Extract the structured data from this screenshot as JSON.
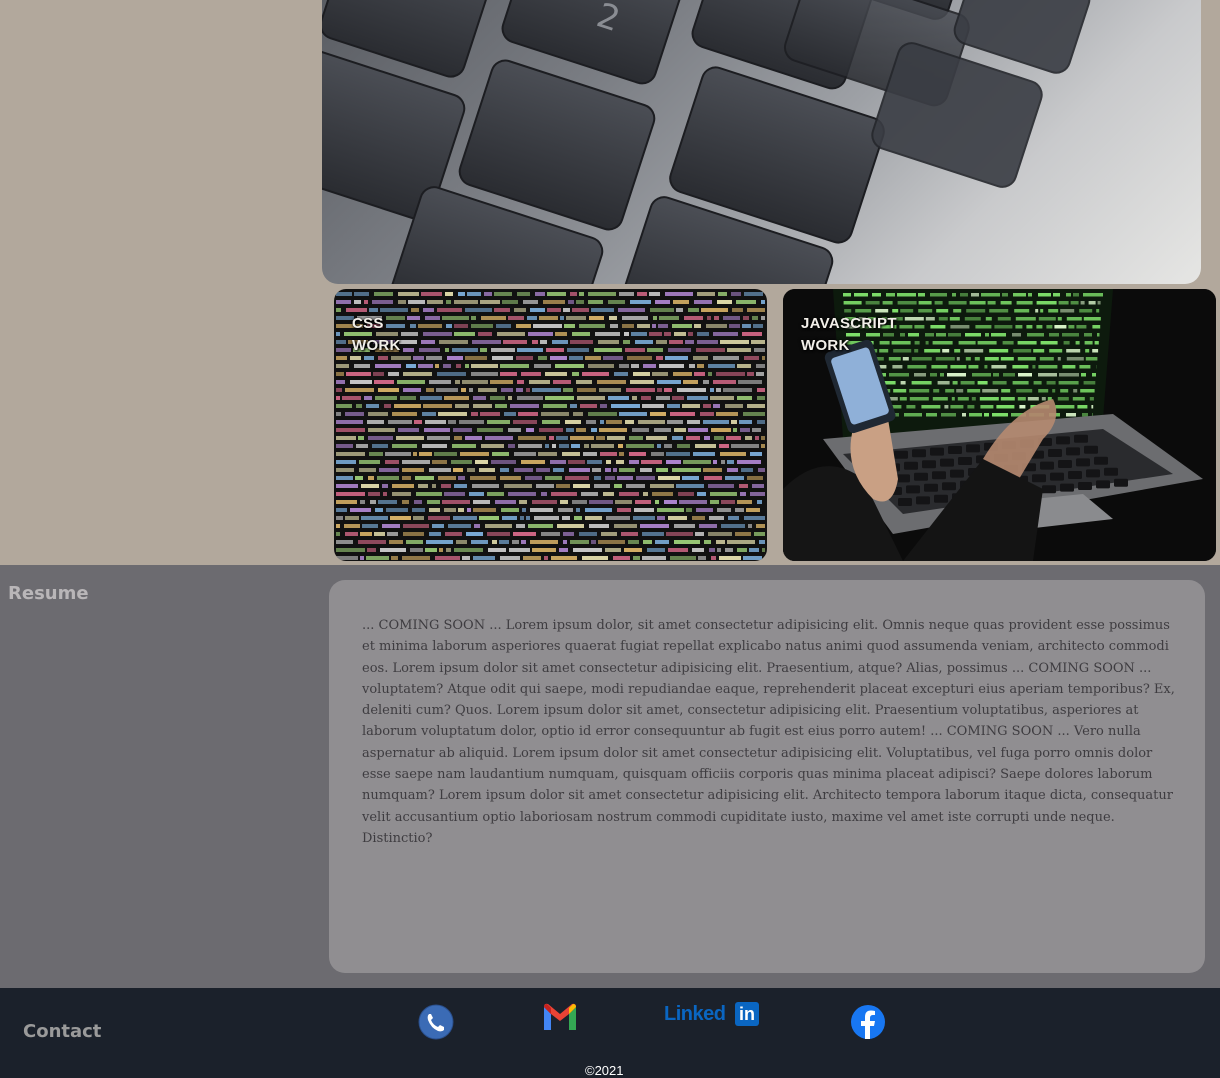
{
  "portfolio": {
    "hero_image_icon": "keyboard-photo",
    "cards": [
      {
        "line1": "CSS",
        "line2": "WORK",
        "image_icon": "code-screen-photo"
      },
      {
        "line1": "JAVASCRIPT",
        "line2": "WORK",
        "image_icon": "laptop-phone-photo"
      }
    ]
  },
  "resume": {
    "title": "Resume",
    "body": "... COMING SOON ... Lorem ipsum dolor, sit amet consectetur adipisicing elit. Omnis neque quas provident esse possimus et minima laborum asperiores quaerat fugiat repellat explicabo natus animi quod assumenda veniam, architecto commodi eos. Lorem ipsum dolor sit amet consectetur adipisicing elit. Praesentium, atque? Alias, possimus ... COMING SOON ... voluptatem? Atque odit qui saepe, modi repudiandae eaque, reprehenderit placeat excepturi eius aperiam temporibus? Ex, deleniti cum? Quos. Lorem ipsum dolor sit amet, consectetur adipisicing elit. Praesentium voluptatibus, asperiores at laborum voluptatum dolor, optio id error consequuntur ab fugit est eius porro autem! ... COMING SOON ... Vero nulla aspernatur ab aliquid. Lorem ipsum dolor sit amet consectetur adipisicing elit. Voluptatibus, vel fuga porro omnis dolor esse saepe nam laudantium numquam, quisquam officiis corporis quas minima placeat adipisci? Saepe dolores laborum numquam? Lorem ipsum dolor sit amet consectetur adipisicing elit. Architecto tempora laborum itaque dicta, consequatur velit accusantium optio laboriosam nostrum commodi cupiditate iusto, maxime vel amet iste corrupti unde neque. Distinctio?"
  },
  "footer": {
    "title": "Contact",
    "linkedin_text": "Linked",
    "linkedin_in": "in",
    "copyright": "©2021",
    "icons": [
      "phone-icon",
      "gmail-icon",
      "linkedin-icon",
      "facebook-icon"
    ],
    "colors": {
      "phone": "#3b6bb5",
      "facebook": "#1877f2",
      "linkedin": "#0a66c2",
      "background": "#1b212b"
    }
  }
}
